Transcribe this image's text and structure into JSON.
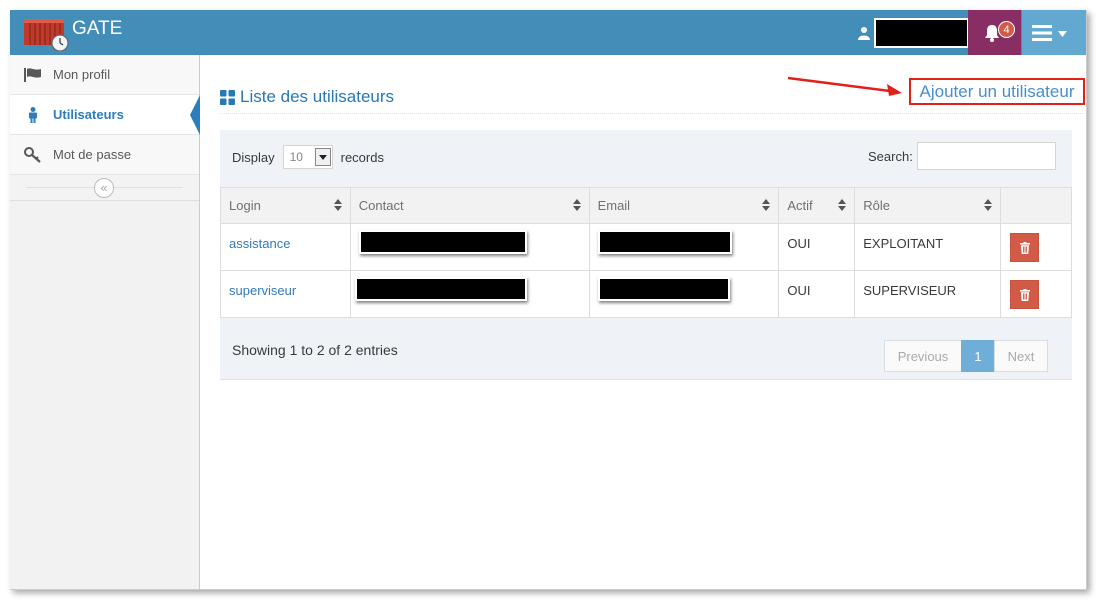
{
  "app": {
    "brand": "GATE"
  },
  "navbar": {
    "notifications_count": "4"
  },
  "sidebar": {
    "items": [
      {
        "label": "Mon profil",
        "icon": "flag-icon",
        "active": false
      },
      {
        "label": "Utilisateurs",
        "icon": "user-icon",
        "active": true
      },
      {
        "label": "Mot de passe",
        "icon": "key-icon",
        "active": false
      }
    ],
    "collapse_glyph": "«"
  },
  "page": {
    "title": "Liste des utilisateurs",
    "add_user_label": "Ajouter un utilisateur"
  },
  "table_controls": {
    "display_label": "Display",
    "page_size": "10",
    "records_label": "records",
    "search_label": "Search:",
    "search_value": ""
  },
  "table": {
    "columns": [
      "Login",
      "Contact",
      "Email",
      "Actif",
      "Rôle"
    ],
    "rows": [
      {
        "login": "assistance",
        "contact": "",
        "email": "",
        "actif": "OUI",
        "role": "EXPLOITANT"
      },
      {
        "login": "superviseur",
        "contact": "",
        "email": "",
        "actif": "OUI",
        "role": "SUPERVISEUR"
      }
    ]
  },
  "footer": {
    "showing": "Showing 1 to 2 of 2 entries",
    "pagination": {
      "previous": "Previous",
      "current": "1",
      "next": "Next"
    }
  },
  "colors": {
    "navbar": "#438eb9",
    "notification_bg": "#892e65",
    "menu_bg": "#62a8d1",
    "accent": "#2679b5",
    "delete": "#d15b47",
    "highlight_box": "#e0211a"
  }
}
